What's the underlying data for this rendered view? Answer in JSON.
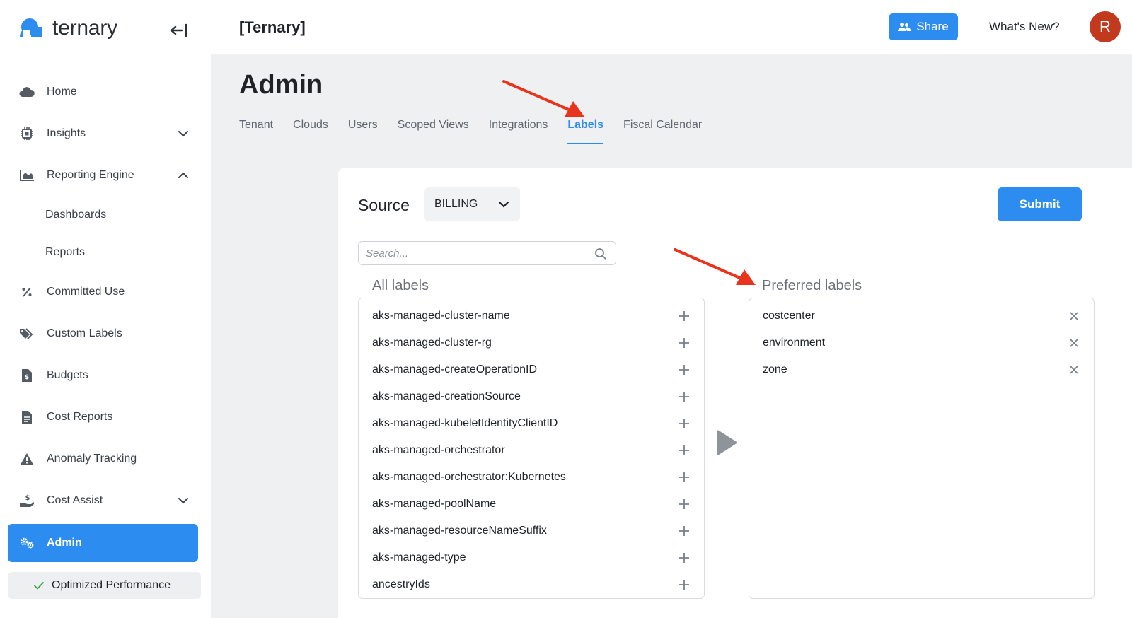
{
  "brand": {
    "name": "ternary"
  },
  "topbar": {
    "org_name": "[Ternary]",
    "share_label": "Share",
    "whats_new_label": "What's New?",
    "avatar_initial": "R"
  },
  "sidebar": {
    "items": [
      {
        "label": "Home",
        "icon": "cloud-icon"
      },
      {
        "label": "Insights",
        "icon": "chip-icon",
        "expandable": true,
        "expanded": false
      },
      {
        "label": "Reporting Engine",
        "icon": "area-chart-icon",
        "expandable": true,
        "expanded": true
      },
      {
        "label": "Dashboards",
        "sub": true
      },
      {
        "label": "Reports",
        "sub": true
      },
      {
        "label": "Committed Use",
        "icon": "percent-icon"
      },
      {
        "label": "Custom Labels",
        "icon": "tags-icon"
      },
      {
        "label": "Budgets",
        "icon": "invoice-icon"
      },
      {
        "label": "Cost Reports",
        "icon": "document-icon"
      },
      {
        "label": "Anomaly Tracking",
        "icon": "warning-icon"
      },
      {
        "label": "Cost Assist",
        "icon": "hand-dollar-icon",
        "expandable": true,
        "expanded": false
      },
      {
        "label": "Admin",
        "icon": "gears-icon",
        "active": true
      }
    ],
    "status_badge": "Optimized Performance"
  },
  "page": {
    "title": "Admin",
    "tabs": [
      "Tenant",
      "Clouds",
      "Users",
      "Scoped Views",
      "Integrations",
      "Labels",
      "Fiscal Calendar"
    ],
    "active_tab": "Labels"
  },
  "labels_panel": {
    "source_label": "Source",
    "source_value": "BILLING",
    "submit_label": "Submit",
    "search_placeholder": "Search...",
    "all_labels_title": "All labels",
    "preferred_labels_title": "Preferred labels",
    "all_labels": [
      "aks-managed-cluster-name",
      "aks-managed-cluster-rg",
      "aks-managed-createOperationID",
      "aks-managed-creationSource",
      "aks-managed-kubeletIdentityClientID",
      "aks-managed-orchestrator",
      "aks-managed-orchestrator:Kubernetes",
      "aks-managed-poolName",
      "aks-managed-resourceNameSuffix",
      "aks-managed-type",
      "ancestryIds"
    ],
    "preferred_labels": [
      "costcenter",
      "environment",
      "zone"
    ]
  },
  "colors": {
    "accent": "#2d8cf0",
    "annotation_arrow": "#e8341c",
    "avatar": "#c2391d",
    "success": "#3fa14a"
  }
}
